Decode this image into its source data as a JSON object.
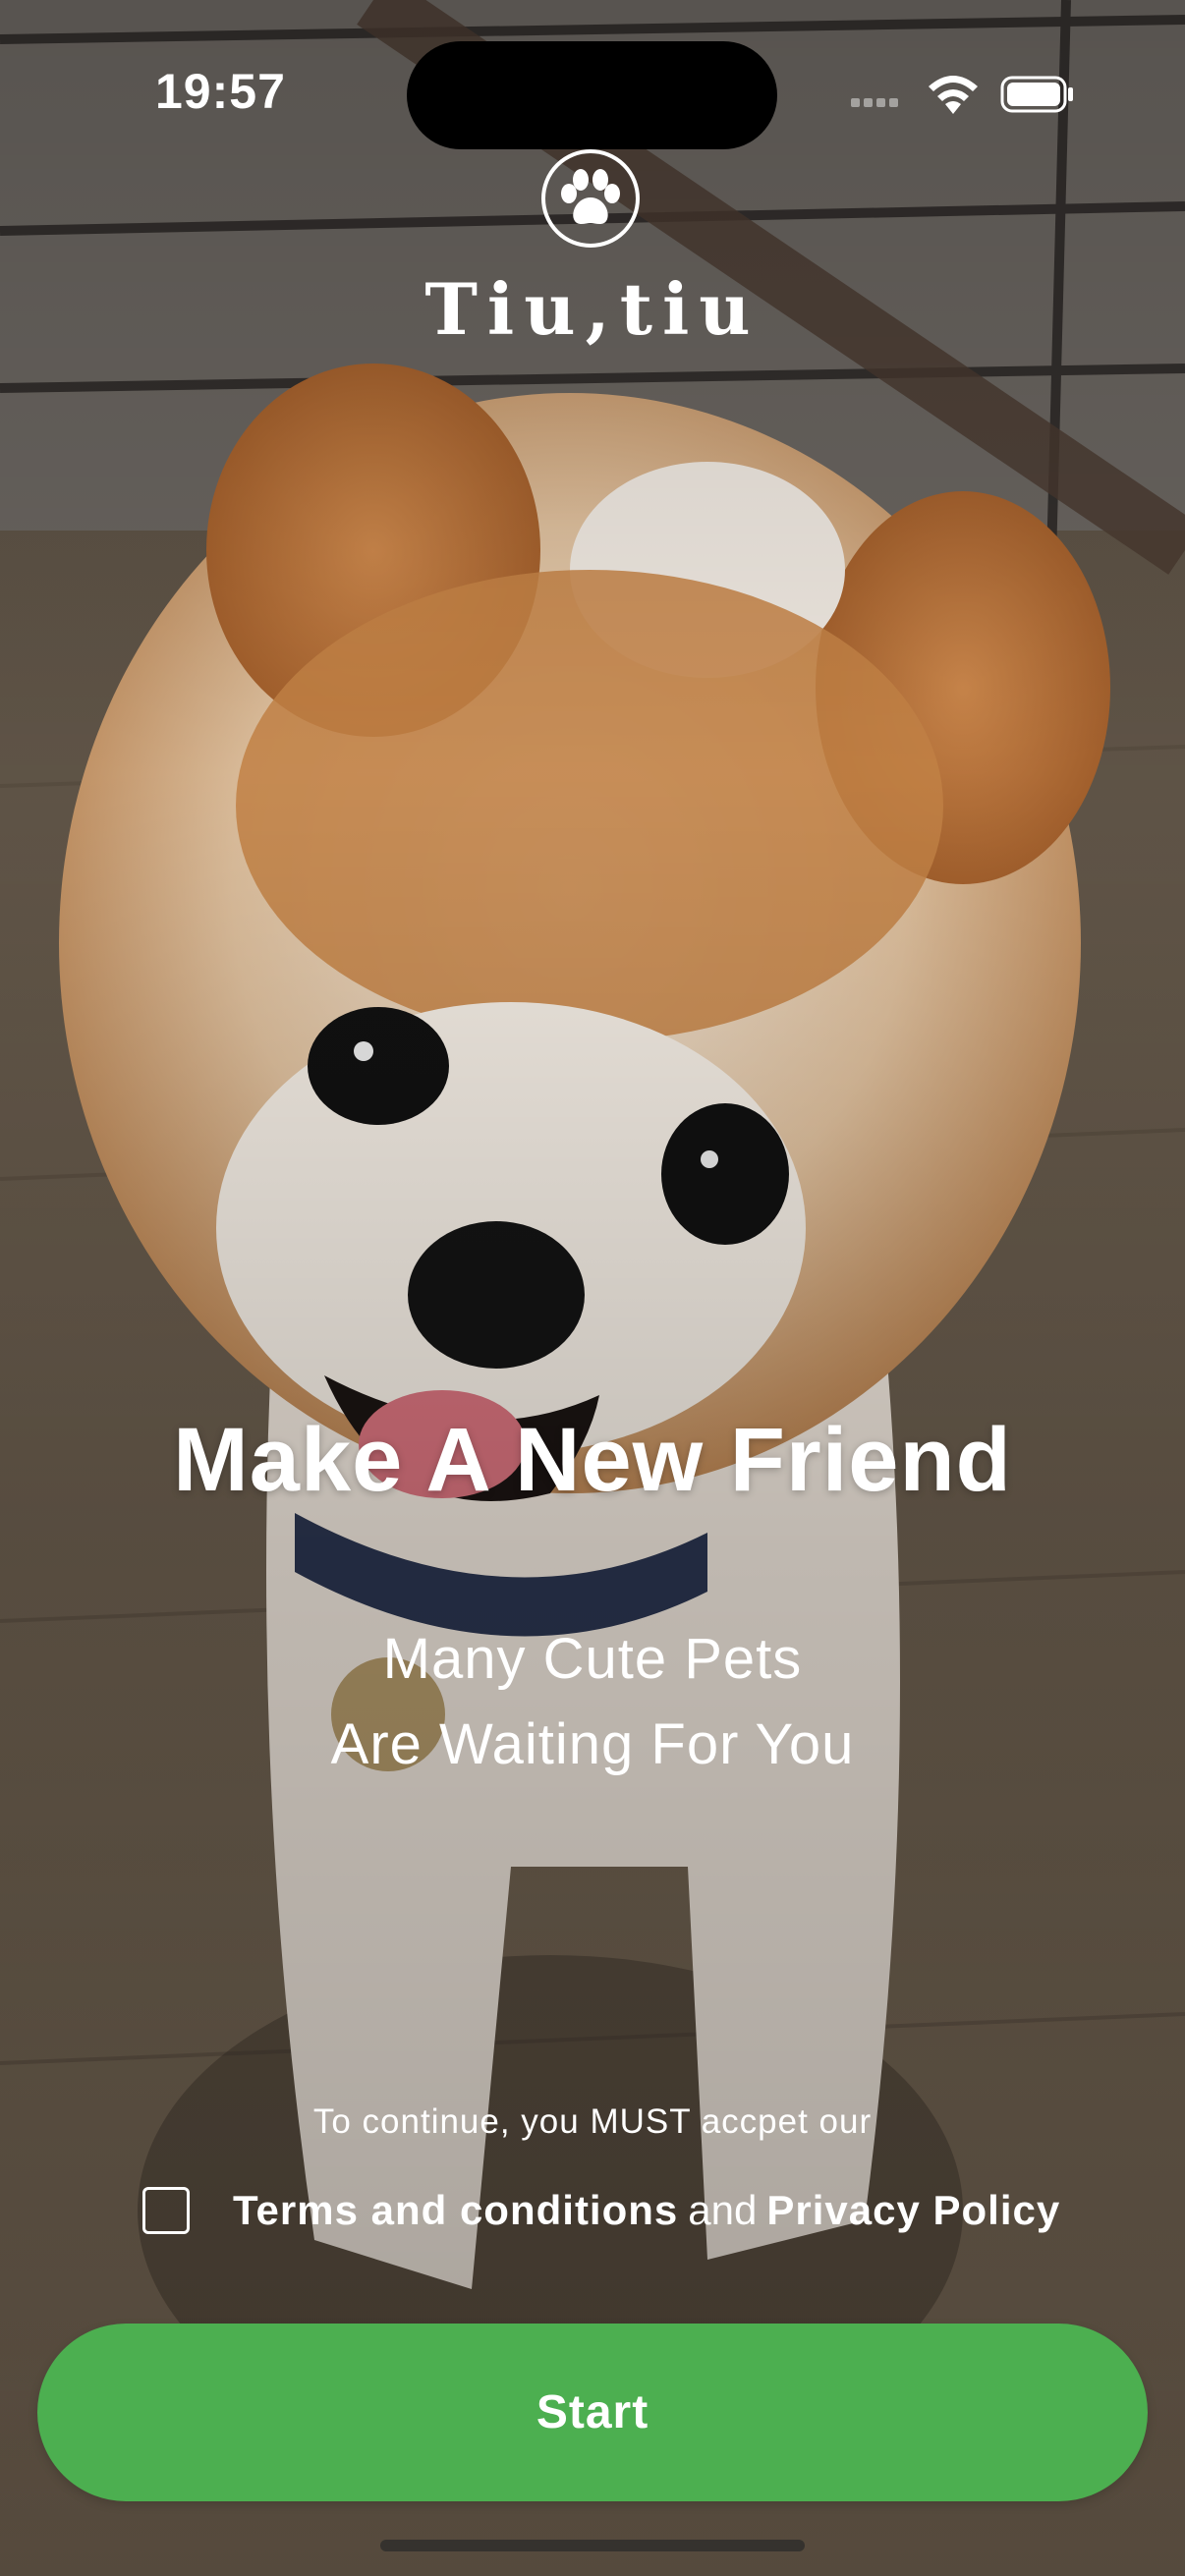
{
  "status_bar": {
    "time": "19:57"
  },
  "brand": {
    "logo_icon": "paw-icon",
    "name": "Tiu,tiu"
  },
  "hero": {
    "headline": "Make A New Friend",
    "subline_1": "Many Cute Pets",
    "subline_2": "Are Waiting For You"
  },
  "terms": {
    "notice": "To continue, you MUST accpet our",
    "checked": false,
    "terms_link": "Terms and conditions",
    "and_text": "and",
    "privacy_link": "Privacy Policy"
  },
  "start_button": {
    "label": "Start",
    "color": "#4caf50"
  }
}
